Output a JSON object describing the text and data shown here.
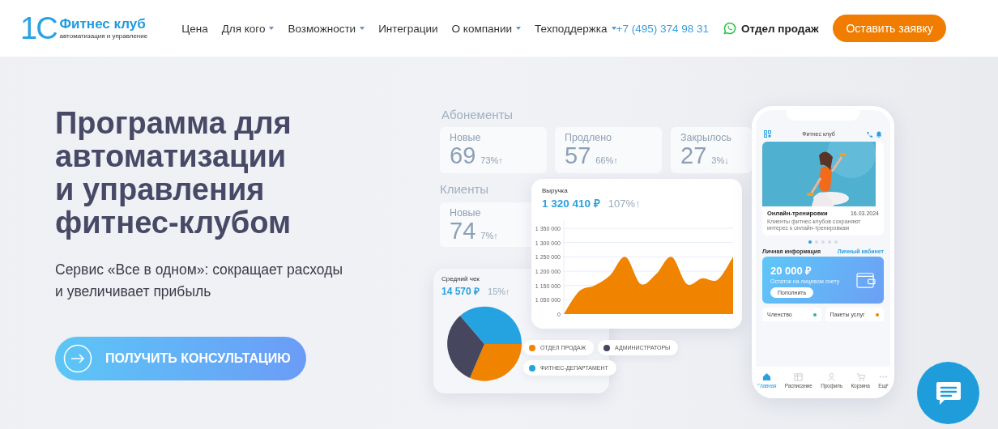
{
  "header": {
    "logo": {
      "mark": "1С",
      "title": "Фитнес клуб",
      "subtitle": "автоматизация и управление"
    },
    "nav": [
      {
        "label": "Цена",
        "dropdown": false
      },
      {
        "label": "Для кого",
        "dropdown": true
      },
      {
        "label": "Возможности",
        "dropdown": true
      },
      {
        "label": "Интеграции",
        "dropdown": false
      },
      {
        "label": "О компании",
        "dropdown": true
      },
      {
        "label": "Техподдержка",
        "dropdown": true
      }
    ],
    "phone": "+7 (495) 374 98 31",
    "sales": "Отдел продаж",
    "cta": "Оставить заявку"
  },
  "hero": {
    "title": "Программа для\nавтоматизации\nи управления\nфитнес-клубом",
    "subtitle": "Сервис «Все в одном»: сокращает расходы\nи увеличивает прибыль",
    "button": "ПОЛУЧИТЬ КОНСУЛЬТАЦИЮ"
  },
  "dashboard": {
    "subscriptions": {
      "title": "Абонементы",
      "cards": [
        {
          "label": "Новые",
          "value": "69",
          "change": "73%↑"
        },
        {
          "label": "Продлено",
          "value": "57",
          "change": "66%↑"
        },
        {
          "label": "Закрылось",
          "value": "27",
          "change": "3%↓"
        }
      ]
    },
    "clients": {
      "title": "Клиенты",
      "cards": [
        {
          "label": "Новые",
          "value": "74",
          "change": "7%↑"
        }
      ]
    },
    "revenue": {
      "label": "Выручка",
      "value": "1 320 410 ₽",
      "change": "107%↑",
      "y_axis_labels": [
        "1 350 000",
        "1 300 000",
        "1 250 000",
        "1 200 000",
        "1 150 000",
        "1 050 000",
        "0"
      ]
    },
    "average_check": {
      "label": "Средний чек",
      "value": "14 570 ₽",
      "change": "15%↑",
      "legend": [
        {
          "label": "ОТДЕЛ ПРОДАЖ",
          "color": "#f08300"
        },
        {
          "label": "АДМИНИСТРАТОРЫ",
          "color": "#46465f"
        },
        {
          "label": "ФИТНЕС-ДЕПАРТАМЕНТ",
          "color": "#25a3e0"
        }
      ]
    }
  },
  "phone_app": {
    "title": "Фитнес клуб",
    "news": {
      "kind": "picture",
      "title": "Онлайн-тренировки",
      "date": "16.03.2024",
      "text": "Клиенты фитнес-клубов сохраняют интерес к онлайн-тренировкам"
    },
    "dots": [
      {
        "selected": true
      },
      {
        "selected": false
      },
      {
        "selected": false
      },
      {
        "selected": false
      },
      {
        "selected": false
      }
    ],
    "section": "Личная информация",
    "section_link": "Личный кабинет",
    "balance": {
      "amount": "20 000 ₽",
      "caption": "Остаток на лицевом счету",
      "button": "Пополнить"
    },
    "tiles": [
      {
        "label": "Членство",
        "color": "#2bb5a6"
      },
      {
        "label": "Пакеты услуг",
        "color": "#f08300"
      }
    ],
    "tabbar": [
      {
        "label": "Главная",
        "selected": true
      },
      {
        "label": "Расписание",
        "selected": false
      },
      {
        "label": "Профиль",
        "selected": false
      },
      {
        "label": "Корзина",
        "selected": false
      },
      {
        "label": "Ещё",
        "selected": false
      }
    ]
  }
}
